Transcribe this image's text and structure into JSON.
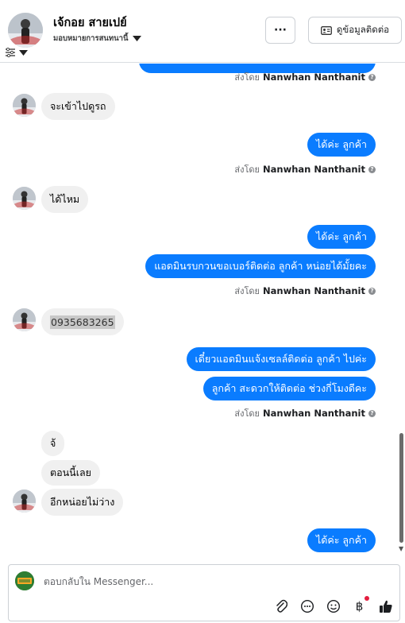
{
  "header": {
    "contact_name": "เจ้กอย สายเปย์",
    "assign_label": "มอบหมายการสนทนานี้",
    "more_label": "···",
    "info_label": "ดูข้อมูลติดต่อ"
  },
  "sent_by": {
    "prefix": "ส่งโดย",
    "name": "Nanwhan Nanthanit"
  },
  "messages": {
    "in_1": "จะเข้าไปดูรถ",
    "out_1": "ได้ค่ะ  ลูกค้า",
    "in_2": "ได้ไหม",
    "out_2": "ได้ค่ะ  ลูกค้า",
    "out_3": "แอดมินรบกวนขอเบอร์ติดต่อ ลูกค้า หน่อยได้มั้ยคะ",
    "in_3": "0935683265",
    "out_4": "เดี๋ยวแอดมินแจ้งเซลล์ติดต่อ ลูกค้า ไปค่ะ",
    "out_5": "ลูกค้า สะดวกให้ติดต่อ ช่วงกี่โมงดีคะ",
    "in_4": "จ้",
    "in_5": "ตอนนี้เลย",
    "in_6": "อีกหน่อยไม่ว่าง",
    "out_6": "ได้ค่ะ  ลูกค้า"
  },
  "composer": {
    "placeholder": "ตอบกลับใน Messenger..."
  },
  "colors": {
    "outgoing_bubble": "#0a7cff",
    "incoming_bubble": "#f0f0f0",
    "notification_dot": "#e41e3f"
  },
  "icons": [
    "filter-icon",
    "chevron-down-icon",
    "more-icon",
    "contact-card-icon",
    "info-icon",
    "attach-icon",
    "saved-reply-icon",
    "emoji-icon",
    "baht-icon",
    "thumbs-up-icon"
  ]
}
